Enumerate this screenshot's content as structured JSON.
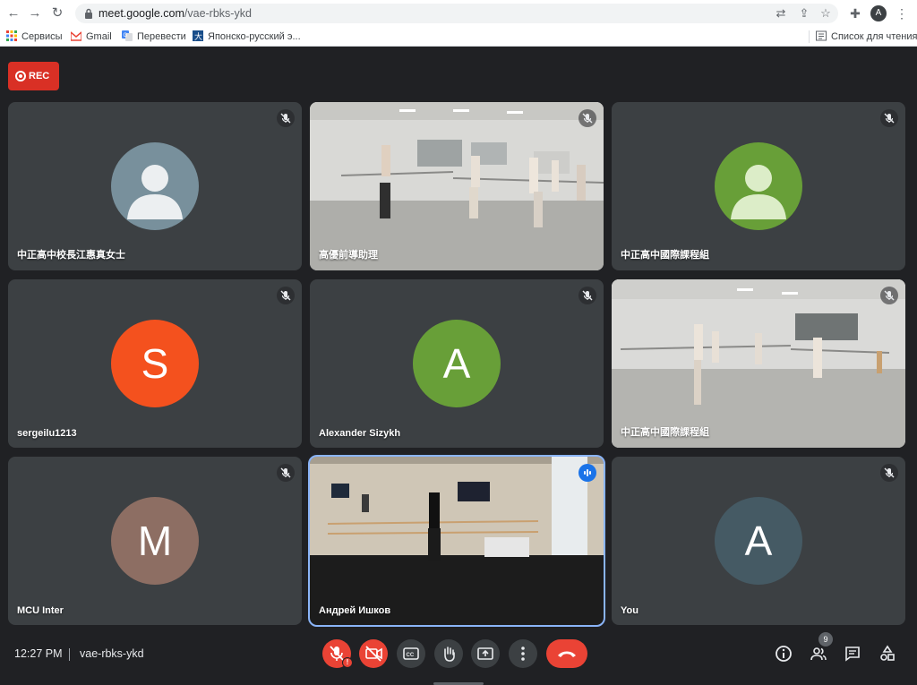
{
  "browser": {
    "url_host": "meet.google.com",
    "url_path": "/vae-rbks-ykd",
    "profile_initial": "A",
    "bookmarks": [
      "Сервисы",
      "Gmail",
      "Перевести",
      "Японско-русский э..."
    ],
    "reading_list": "Список для чтения"
  },
  "meet": {
    "rec_label": "REC",
    "tiles": [
      {
        "name": "中正高中校長江惠真女士",
        "type": "avatar",
        "avatar_color": "#78909c",
        "muted": true
      },
      {
        "name": "高優前導助理",
        "type": "video",
        "muted": true
      },
      {
        "name": "中正高中國際課程組",
        "type": "avatar",
        "avatar_color": "#689f38",
        "muted": true
      },
      {
        "name": "sergeilu1213",
        "type": "avatar",
        "initial": "S",
        "avatar_color": "#f4511e",
        "muted": true
      },
      {
        "name": "Alexander Sizykh",
        "type": "avatar",
        "initial": "A",
        "avatar_color": "#689f38",
        "muted": true
      },
      {
        "name": "中正高中國際課程組",
        "type": "video",
        "muted": true
      },
      {
        "name": "MCU Inter",
        "type": "avatar",
        "initial": "M",
        "avatar_color": "#8d6e63",
        "muted": true
      },
      {
        "name": "Андрей Ишков",
        "type": "video",
        "muted": false,
        "speaking": true
      },
      {
        "name": "You",
        "type": "avatar",
        "initial": "A",
        "avatar_color": "#455a64",
        "muted": true
      }
    ],
    "time": "12:27 PM",
    "meeting_code": "vae-rbks-ykd",
    "participants_count": "9"
  }
}
